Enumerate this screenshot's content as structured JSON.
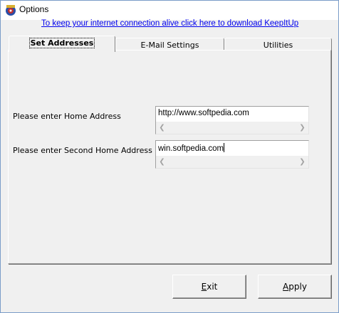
{
  "window": {
    "title": "Options",
    "icon": "keepitup-app-icon"
  },
  "promo_link": "To keep your internet connection alive click here to download KeepItUp",
  "tabs": [
    {
      "label": "Set Addresses",
      "active": true
    },
    {
      "label": "E-Mail Settings",
      "active": false
    },
    {
      "label": "Utilities",
      "active": false
    }
  ],
  "set_addresses": {
    "home_address_label": "Please enter Home Address",
    "home_address_value": "http://www.softpedia.com",
    "second_home_address_label": "Please enter Second Home Address",
    "second_home_address_value": "win.softpedia.com"
  },
  "buttons": {
    "exit": {
      "mnemonic": "E",
      "rest": "xit"
    },
    "apply": {
      "mnemonic": "A",
      "rest": "pply"
    }
  },
  "icons": {
    "scroll_left": "scroll-left-arrow-icon",
    "scroll_right": "scroll-right-arrow-icon"
  }
}
